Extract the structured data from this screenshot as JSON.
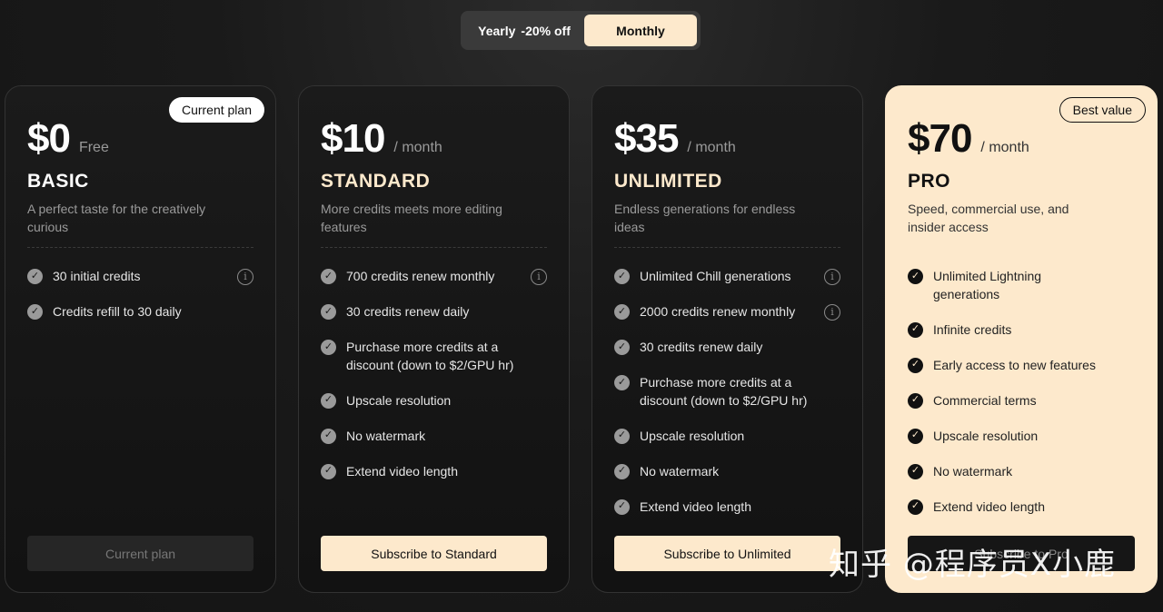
{
  "billing_toggle": {
    "yearly_label": "Yearly",
    "yearly_discount": "-20% off",
    "monthly_label": "Monthly",
    "selected": "Monthly"
  },
  "plans": [
    {
      "price": "$0",
      "period": "Free",
      "name": "BASIC",
      "description": "A perfect taste for the creatively curious",
      "badge": "Current plan",
      "features": [
        "30 initial credits",
        "Credits refill to 30 daily"
      ],
      "cta": "Current plan"
    },
    {
      "price": "$10",
      "period": "/ month",
      "name": "STANDARD",
      "description": "More credits meets more editing features",
      "features": [
        "700 credits renew monthly",
        "30 credits renew daily",
        "Purchase more credits at a discount (down to $2/GPU hr)",
        "Upscale resolution",
        "No watermark",
        "Extend video length"
      ],
      "cta": "Subscribe to Standard"
    },
    {
      "price": "$35",
      "period": "/ month",
      "name": "UNLIMITED",
      "description": "Endless generations for endless ideas",
      "features": [
        "Unlimited Chill generations",
        "2000 credits renew monthly",
        "30 credits renew daily",
        "Purchase more credits at a discount (down to $2/GPU hr)",
        "Upscale resolution",
        "No watermark",
        "Extend video length"
      ],
      "cta": "Subscribe to Unlimited"
    },
    {
      "price": "$70",
      "period": "/ month",
      "name": "PRO",
      "description": "Speed, commercial use, and insider access",
      "badge": "Best value",
      "features": [
        "Unlimited Lightning generations",
        "Infinite credits",
        "Early access to new features",
        "Commercial terms",
        "Upscale resolution",
        "No watermark",
        "Extend video length"
      ],
      "cta": "Subscribe to Pro"
    }
  ],
  "icons": {
    "check": "✓",
    "info": "i"
  },
  "watermark": "知乎 @程序员X小鹿",
  "colors": {
    "accent": "#fde9cc",
    "background": "#141414"
  }
}
